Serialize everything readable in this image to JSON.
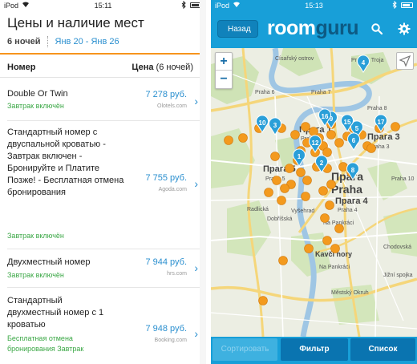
{
  "left": {
    "status": {
      "carrier": "iPod",
      "time": "15:11"
    },
    "title": "Цены и наличие мест",
    "nights": "6 ночей",
    "dates": "Янв 20 - Янв 26",
    "col_room": "Номер",
    "col_price_bold": "Цена",
    "col_price_rest": "(6 ночей)",
    "rows": [
      {
        "name": "Double Or Twin",
        "note": "Завтрак включён",
        "price": "7 278 руб.",
        "source": "Olotels.com"
      },
      {
        "name": "Стандартный номер с двуспальной кроватью - Завтрак включен - Бронируйте и Платите Позже! - Бесплатная отмена бронирования",
        "note": "Завтрак включён",
        "price": "7 755 руб.",
        "source": "Agoda.com"
      },
      {
        "name": "Двухместный номер",
        "note": "Завтрак включён",
        "price": "7 944 руб.",
        "source": "hrs.com"
      },
      {
        "name": "Стандартный двухместный номер с 1 кроватью",
        "note": "Бесплатная отмена бронирования Завтрак",
        "price": "7 948 руб.",
        "source": "Booking.com"
      }
    ]
  },
  "right": {
    "status": {
      "carrier": "iPod",
      "time": "15:13"
    },
    "back": "Назад",
    "logo_a": "room",
    "logo_b": "guru",
    "zoom_in": "+",
    "zoom_out": "−",
    "labels": {
      "l1": "Praha - Troja",
      "l2": "Císařský ostrov",
      "l3": "Praha 6",
      "l4": "Praha 7",
      "l5": "Прага 1",
      "l6": "Praha 1",
      "l7": "Praha 8",
      "l8": "Прага 3",
      "l9": "Praha 3",
      "l10": "Прага 5",
      "l11": "Praha 5",
      "l12": "Прага",
      "l13": "Praha",
      "l14": "Прага 4",
      "l15": "Praha 4",
      "l16": "Vyšehrad",
      "l17": "Kavčí hory",
      "l18": "Městský Okruh",
      "l19": "Jižní spojka",
      "l20": "Dobříšská",
      "l21": "Radlická",
      "l22": "Na Pankráci",
      "l23": "Na Pankráci",
      "l24": "Chodovská",
      "l25": "Praha 10"
    },
    "markers": [
      "1",
      "2",
      "3",
      "4",
      "5",
      "6",
      "8",
      "9",
      "10",
      "12",
      "15",
      "16",
      "17"
    ],
    "buttons": {
      "sort": "Сортировать",
      "filter": "Фильтр",
      "list": "Список"
    },
    "colors": {
      "accent": "#189fd8",
      "marker": "#2a9fd8",
      "hotel_dot": "#f39a1e"
    }
  }
}
